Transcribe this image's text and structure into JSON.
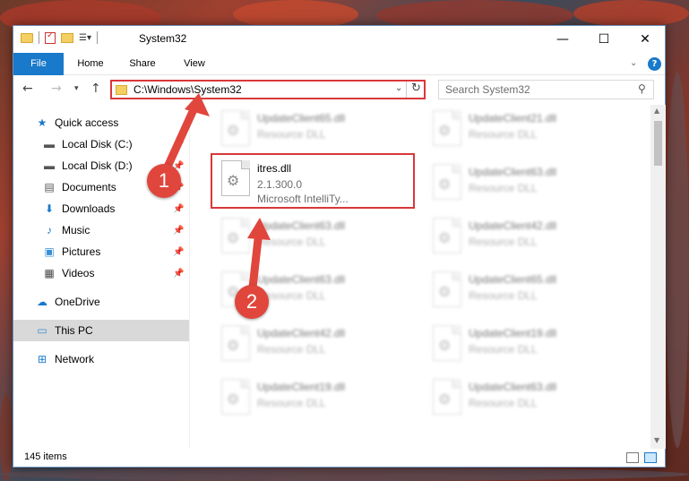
{
  "window": {
    "title": "System32",
    "min_glyph": "—",
    "max_glyph": "☐",
    "close_glyph": "✕"
  },
  "ribbon": {
    "tabs": [
      "File",
      "Home",
      "Share",
      "View"
    ],
    "chevron": "⌄",
    "help": "?"
  },
  "navbar": {
    "back": "←",
    "forward": "→",
    "recent": "▾",
    "up": "↑",
    "address_path": "C:\\Windows\\System32",
    "address_dropdown": "⌄",
    "refresh": "↻",
    "search_placeholder": "Search System32",
    "search_icon": "⚲"
  },
  "sidebar": {
    "items": [
      {
        "label": "Quick access",
        "icon": "★",
        "pinned": false
      },
      {
        "label": "Local Disk (C:)",
        "icon": "▬",
        "pinned": true
      },
      {
        "label": "Local Disk (D:)",
        "icon": "▬",
        "pinned": true
      },
      {
        "label": "Documents",
        "icon": "▤",
        "pinned": true
      },
      {
        "label": "Downloads",
        "icon": "⬇",
        "pinned": true
      },
      {
        "label": "Music",
        "icon": "♪",
        "pinned": true
      },
      {
        "label": "Pictures",
        "icon": "▣",
        "pinned": true
      },
      {
        "label": "Videos",
        "icon": "▦",
        "pinned": true
      },
      {
        "label": "OneDrive",
        "icon": "☁",
        "pinned": false
      },
      {
        "label": "This PC",
        "icon": "▭",
        "pinned": false
      },
      {
        "label": "Network",
        "icon": "⊞",
        "pinned": false
      }
    ],
    "pin_glyph": "📌"
  },
  "files": [
    {
      "name": "UpdateClient65.dll",
      "line2": "Resource DLL",
      "line3": ""
    },
    {
      "name": "UpdateClient21.dll",
      "line2": "Resource DLL",
      "line3": ""
    },
    {
      "name": "itres.dll",
      "line2": "2.1.300.0",
      "line3": "Microsoft IntelliTy..."
    },
    {
      "name": "UpdateClient63.dll",
      "line2": "Resource DLL",
      "line3": ""
    },
    {
      "name": "UpdateClient63.dll",
      "line2": "Resource DLL",
      "line3": ""
    },
    {
      "name": "UpdateClient42.dll",
      "line2": "Resource DLL",
      "line3": ""
    },
    {
      "name": "UpdateClient63.dll",
      "line2": "Resource DLL",
      "line3": ""
    },
    {
      "name": "UpdateClient65.dll",
      "line2": "Resource DLL",
      "line3": ""
    },
    {
      "name": "UpdateClient42.dll",
      "line2": "Resource DLL",
      "line3": ""
    },
    {
      "name": "UpdateClient19.dll",
      "line2": "Resource DLL",
      "line3": ""
    },
    {
      "name": "UpdateClient19.dll",
      "line2": "Resource DLL",
      "line3": ""
    },
    {
      "name": "UpdateClient63.dll",
      "line2": "Resource DLL",
      "line3": ""
    }
  ],
  "file_icon": "⚙",
  "status": {
    "count": "145 items"
  },
  "callouts": {
    "one": "1",
    "two": "2"
  },
  "colors": {
    "accent": "#1979ca",
    "highlight": "#d9383a",
    "callout": "#e0463c"
  }
}
